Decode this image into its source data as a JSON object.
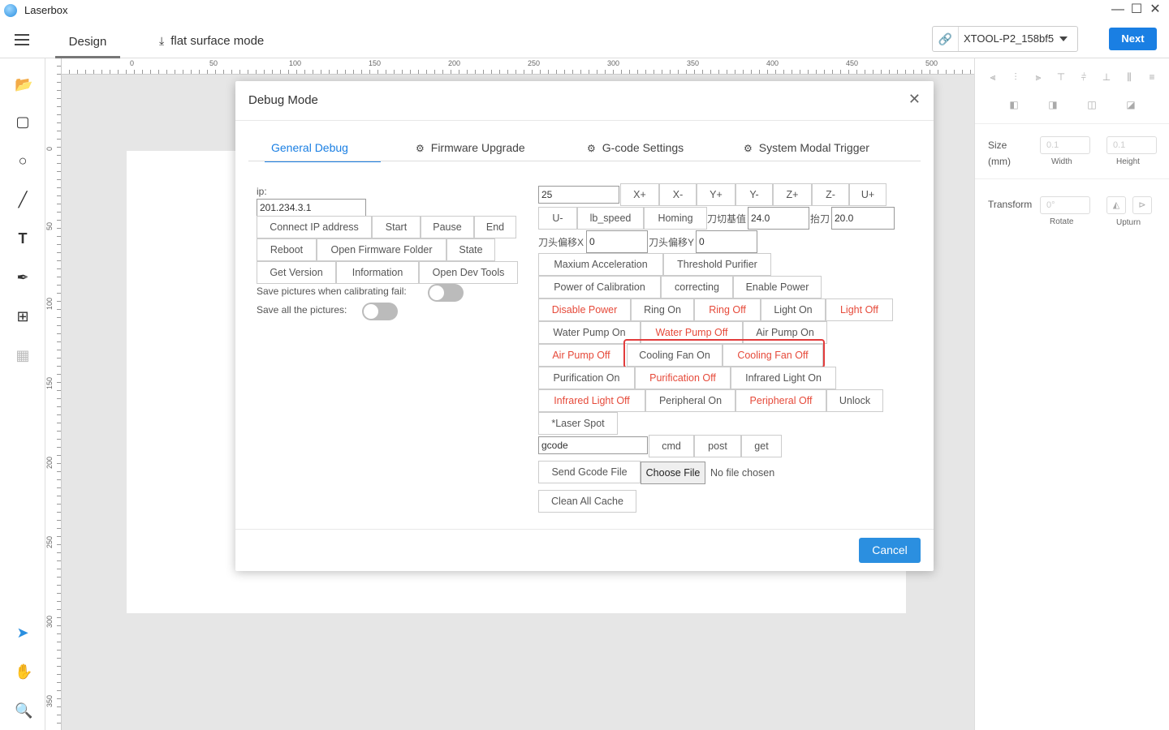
{
  "app": {
    "title": "Laserbox"
  },
  "window": {
    "minimize": "—",
    "maximize": "☐",
    "close": "✕"
  },
  "header": {
    "tabs": [
      {
        "label": "Design"
      },
      {
        "label": "flat surface mode"
      }
    ],
    "device": "XTOOL-P2_158bf5",
    "next_label": "Next"
  },
  "ruler": {
    "h": [
      "0",
      "50",
      "100",
      "150",
      "200",
      "250",
      "300",
      "350",
      "400",
      "450",
      "500"
    ],
    "v": [
      "0",
      "50",
      "100",
      "150",
      "200",
      "250",
      "300",
      "350"
    ]
  },
  "right_panel": {
    "size_label": "Size",
    "size_unit": "(mm)",
    "width_value": "0.1",
    "height_value": "0.1",
    "width_label": "Width",
    "height_label": "Height",
    "transform_label": "Transform",
    "rotate_value": "0°",
    "rotate_label": "Rotate",
    "upturn_label": "Upturn"
  },
  "dialog": {
    "title": "Debug Mode",
    "tabs": [
      {
        "label": "General Debug",
        "icon": "apple-icon"
      },
      {
        "label": "Firmware Upgrade",
        "icon": "android-icon"
      },
      {
        "label": "G-code Settings",
        "icon": "android-icon"
      },
      {
        "label": "System Modal Trigger",
        "icon": "android-icon"
      }
    ],
    "left": {
      "ip_label": "ip:",
      "ip_value": "201.234.3.1",
      "row1": [
        "Connect IP address",
        "Start",
        "Pause",
        "End"
      ],
      "row2": [
        "Reboot",
        "Open Firmware Folder",
        "State"
      ],
      "row3": [
        "Get Version",
        "Information",
        "Open Dev Tools"
      ],
      "save_fail_label": "Save pictures when calibrating fail:",
      "save_all_label": "Save all the pictures:"
    },
    "right": {
      "step_value": "25",
      "axis_buttons": [
        "X+",
        "X-",
        "Y+",
        "Y-",
        "Z+",
        "Z-",
        "U+"
      ],
      "u_minus": "U-",
      "lb_speed": "lb_speed",
      "homing": "Homing",
      "cut_base_label": "刀切基值",
      "cut_base_value": "24.0",
      "lift_label": "抬刀",
      "lift_value": "20.0",
      "offset_x_label": "刀头偏移X",
      "offset_x_value": "0",
      "offset_y_label": "刀头偏移Y",
      "offset_y_value": "0",
      "max_accel": "Maxium Acceleration",
      "threshold_purifier": "Threshold Purifier",
      "power_cal": "Power of Calibration",
      "correcting": "correcting",
      "enable_power": "Enable Power",
      "disable_power": "Disable Power",
      "ring_on": "Ring On",
      "ring_off": "Ring Off",
      "light_on": "Light On",
      "light_off": "Light Off",
      "water_on": "Water Pump On",
      "water_off": "Water Pump Off",
      "air_on": "Air Pump On",
      "air_off": "Air Pump Off",
      "cooling_on": "Cooling Fan On",
      "cooling_off": "Cooling Fan Off",
      "purif_on": "Purification On",
      "purif_off": "Purification Off",
      "ir_on": "Infrared Light On",
      "ir_off": "Infrared Light Off",
      "periph_on": "Peripheral On",
      "periph_off": "Peripheral Off",
      "unlock": "Unlock",
      "laser_spot": "*Laser Spot",
      "gcode_value": "gcode",
      "cmd": "cmd",
      "post": "post",
      "get": "get",
      "send_gcode": "Send Gcode File",
      "choose_file": "Choose File",
      "no_file": "No file chosen",
      "clean_cache": "Clean All Cache"
    },
    "cancel_label": "Cancel"
  }
}
